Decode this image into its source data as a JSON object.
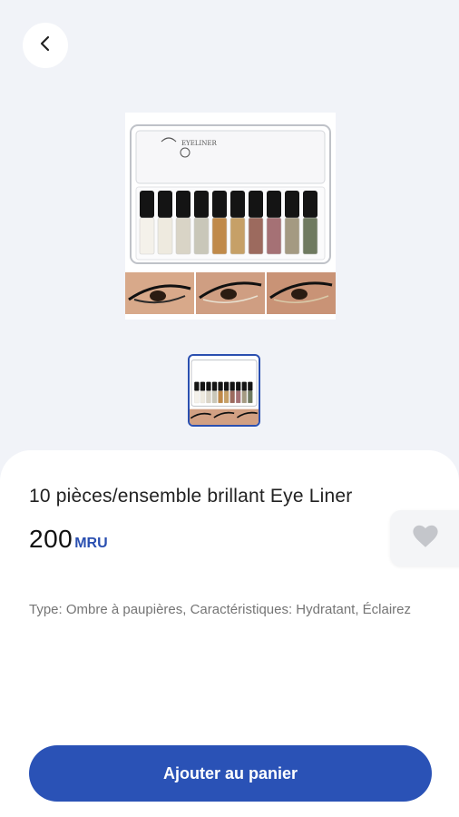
{
  "nav": {
    "back_icon": "chevron-left-icon"
  },
  "product": {
    "title": "10 pièces/ensemble brillant Eye Liner",
    "price": "200",
    "currency": "MRU",
    "description": "Type: Ombre à paupières, Caractéristiques: Hydratant, Éclairez",
    "packaging_text": "EYELINER",
    "pen_colors": [
      "#f4f1ea",
      "#eeeadf",
      "#d9d4c6",
      "#c9c7b9",
      "#c08a4a",
      "#c6a067",
      "#9c6a5e",
      "#a57175",
      "#a49a82",
      "#6f7a60"
    ]
  },
  "gallery": {
    "thumbnail_count": 1,
    "selected_index": 0
  },
  "favorite": {
    "icon": "heart-icon"
  },
  "actions": {
    "add_to_cart_label": "Ajouter au panier"
  },
  "colors": {
    "accent": "#2a52b6",
    "background": "#f1f3f8",
    "sheet": "#ffffff"
  }
}
